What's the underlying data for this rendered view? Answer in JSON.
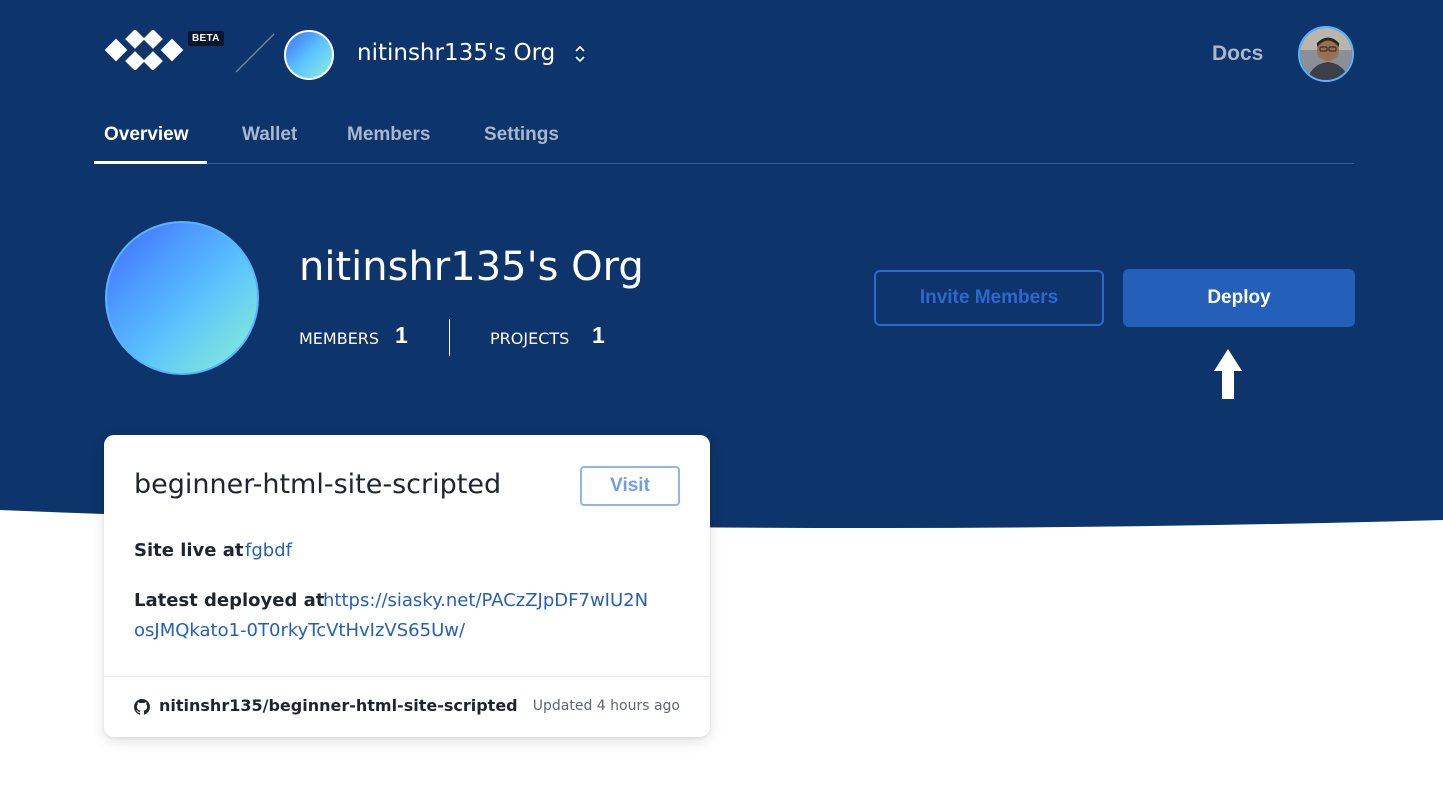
{
  "header": {
    "beta_badge": "BETA",
    "org_name": "nitinshr135's Org",
    "docs_label": "Docs",
    "logo_icon": "skynet-logo-icon",
    "switch_icon": "chevron-up-down-icon"
  },
  "tabs": [
    {
      "label": "Overview",
      "active": true
    },
    {
      "label": "Wallet",
      "active": false
    },
    {
      "label": "Members",
      "active": false
    },
    {
      "label": "Settings",
      "active": false
    }
  ],
  "org": {
    "name": "nitinshr135's Org",
    "members_label": "MEMBERS",
    "members_count": "1",
    "projects_label": "PROJECTS",
    "projects_count": "1",
    "invite_label": "Invite Members",
    "deploy_label": "Deploy"
  },
  "project": {
    "name": "beginner-html-site-scripted",
    "visit_label": "Visit",
    "site_live_label": "Site live at",
    "site_live_value": "fgbdf",
    "latest_deployed_label": "Latest deployed at",
    "latest_deployed_line1": "https://siasky.net/PACzZJpDF7wIU2N",
    "latest_deployed_line2": "osJMQkato1-0T0rkyTcVtHvIzVS65Uw/",
    "repo": "nitinshr135/beginner-html-site-scripted",
    "updated": "Updated 4 hours ago",
    "repo_icon": "github-icon"
  },
  "colors": {
    "hero_bg": "#0d346b",
    "accent": "#2460b9",
    "link": "#2460b9"
  }
}
